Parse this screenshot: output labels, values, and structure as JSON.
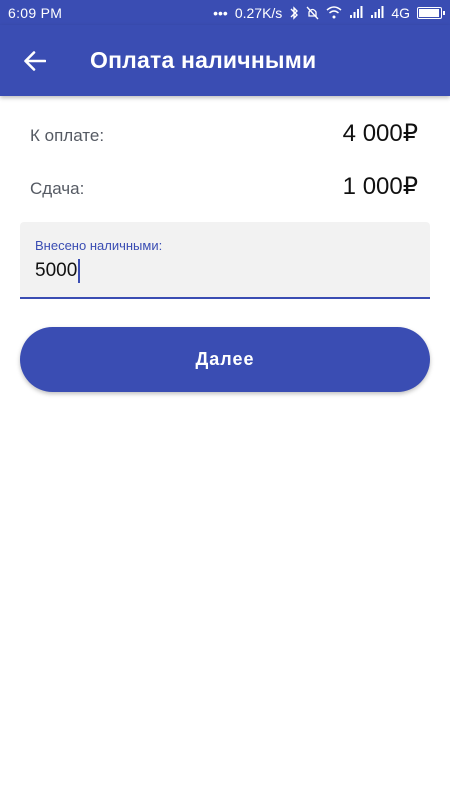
{
  "status_bar": {
    "time": "6:09  PM",
    "dots": "•••",
    "speed": "0.27K/s",
    "network": "4G",
    "icons": [
      "bluetooth-icon",
      "mute-icon",
      "wifi-icon",
      "signal-icon",
      "signal-icon",
      "battery-icon"
    ],
    "battery_level": 0.95
  },
  "app_bar": {
    "title": "Оплата наличными",
    "back_icon": "arrow-left-icon"
  },
  "payment": {
    "amount_label": "К оплате:",
    "amount_value": "4 000₽",
    "change_label": "Сдача:",
    "change_value": "1 000₽"
  },
  "cash_input": {
    "label": "Внесено наличными:",
    "value": "5000"
  },
  "next_button": {
    "label": "Далее"
  },
  "colors": {
    "primary": "#3a4db3",
    "background": "#ffffff",
    "input_bg": "#f2f2f2"
  }
}
